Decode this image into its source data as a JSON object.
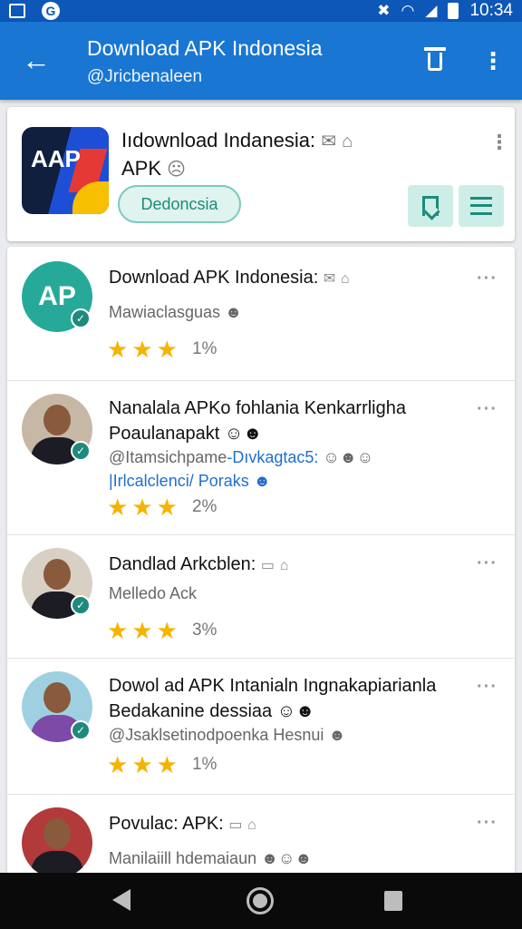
{
  "status_bar": {
    "time": "10:34"
  },
  "app_bar": {
    "title": "Download APK Indonesia",
    "subtitle": "@Jricbenaleen"
  },
  "header_card": {
    "title": "Iıdownload Indanesia:",
    "title_line2": "APK",
    "logo_text": "AAP",
    "chip_label": "Dedoncsia"
  },
  "items": [
    {
      "avatar_text": "AP",
      "title": "Download APK Indonesia:",
      "subtitle": "Mawiaclasguas",
      "rating_pct": "1%"
    },
    {
      "title": "Nanalala APKо fohlania Kenkarrligha",
      "title_line2": "Poaulanapakt",
      "subtitle": "@Itamsichpame",
      "subtitle_link": "-Dıvkagtac5:",
      "subtitle2": "|Irlcalclenci/ Poraks",
      "rating_pct": "2%"
    },
    {
      "title": "Dandlad Arkcblen:",
      "subtitle": "Melledo Ack",
      "rating_pct": "3%"
    },
    {
      "title": "Dowol ad APK Intanialn Ingnakapiarianla",
      "title_line2": "Bedakanine dessiaa",
      "subtitle": "@Jsaklsetinodpoenka Hesnui",
      "rating_pct": "1%"
    },
    {
      "title": "Povulac: APK:",
      "subtitle": "Manilaiill hdemaiaun"
    }
  ],
  "icons": {
    "back": "arrow-left-icon",
    "delete": "trash-icon",
    "more": "more-vert-icon",
    "bookmark": "bookmark-icon",
    "list": "list-icon"
  },
  "colors": {
    "app_bar": "#1976d2",
    "status_bar": "#0d57b8",
    "accent_teal": "#1e8a7c",
    "star": "#f5b400"
  }
}
